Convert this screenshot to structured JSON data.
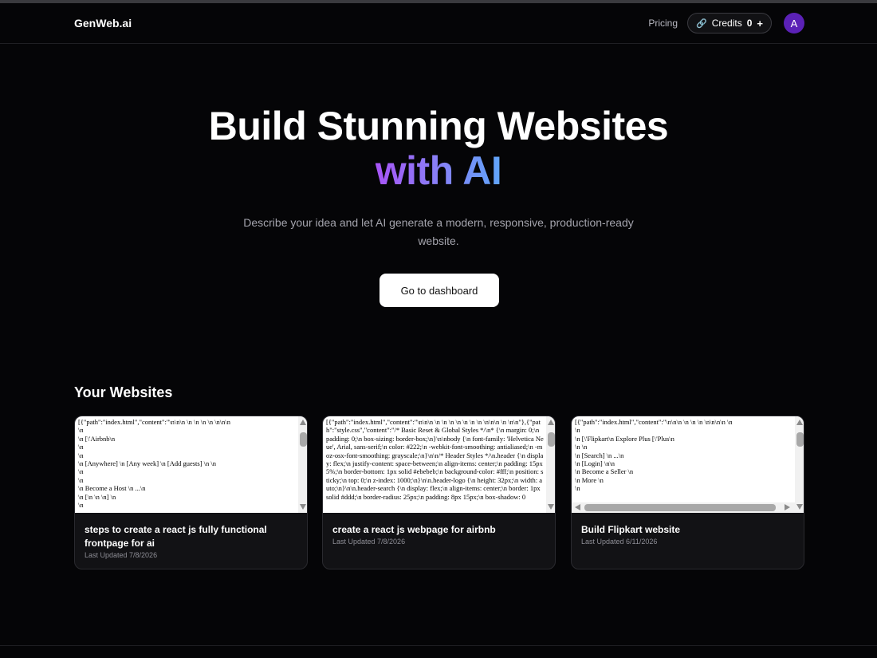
{
  "navbar": {
    "logo": "GenWeb.ai",
    "pricing": "Pricing",
    "credits_label": "Credits",
    "credits_count": "0",
    "credits_add": "+",
    "avatar_letter": "A",
    "coin_icon": "coin-icon"
  },
  "hero": {
    "title_line1": "Build Stunning Websites",
    "title_line2": "with AI",
    "subtitle": "Describe your idea and let AI generate a modern, responsive, production-ready website.",
    "cta": "Go to dashboard",
    "gradient": [
      "#a855f7",
      "#60a5fa"
    ]
  },
  "websites": {
    "heading": "Your Websites",
    "cards": [
      {
        "preview": "[{\"path\":\"index.html\",\"content\":\"\\n\\n\\n \\n \\n \\n \\n \\n\\n\\n\n\\n\n\\n [\\'Airbnb\\n\n\\n\n\\n\n\\n [Anywhere] \\n [Any week] \\n [Add guests] \\n \\n\n\\n\n\\n\n\\n Become a Host \\n ...\\n\n\\n [\\n \\n \\n] \\n\n\\n",
        "title": "steps to create a react js fully functional frontpage for ai",
        "date": "Last Updated 7/8/2026"
      },
      {
        "preview": "[{\"path\":\"index.html\",\"content\":\"\\n\\n\\n \\n \\n \\n \\n \\n \\n \\n \\n\\n\\n \\n \\n\\n\"},{\"path\":\"style.css\",\"content\":\"/* Basic Reset & Global Styles */\\n* {\\n margin: 0;\\n padding: 0;\\n box-sizing: border-box;\\n}\\n\\nbody {\\n font-family: 'Helvetica Neue', Arial, sans-serif;\\n color: #222;\\n -webkit-font-smoothing: antialiased;\\n -moz-osx-font-smoothing: grayscale;\\n}\\n\\n/* Header Styles */\\n.header {\\n display: flex;\\n justify-content: space-between;\\n align-items: center;\\n padding: 15px 5%;\\n border-bottom: 1px solid #ebebeb;\\n background-color: #fff;\\n position: sticky;\\n top: 0;\\n z-index: 1000;\\n}\\n\\n.header-logo {\\n height: 32px;\\n width: auto;\\n}\\n\\n.header-search {\\n display: flex;\\n align-items: center;\\n border: 1px solid #ddd;\\n border-radius: 25px;\\n padding: 8px 15px;\\n box-shadow: 0",
        "title": "create a react js webpage for airbnb",
        "date": "Last Updated 7/8/2026"
      },
      {
        "preview": "[{\"path\":\"index.html\",\"content\":\"\\n\\n\\n \\n \\n \\n \\n\\n\\n\\n \\n\n\\n\n\\n [\\'Flipkart\\n Explore Plus [\\'Plus\\n\n\\n \\n\n\\n [Search] \\n ...\\n\n\\n [Login] \\n\\n\n\\n Become a Seller \\n\n\\n More \\n\n\\n",
        "title": "Build Flipkart website",
        "date": "Last Updated 6/11/2026"
      }
    ]
  }
}
